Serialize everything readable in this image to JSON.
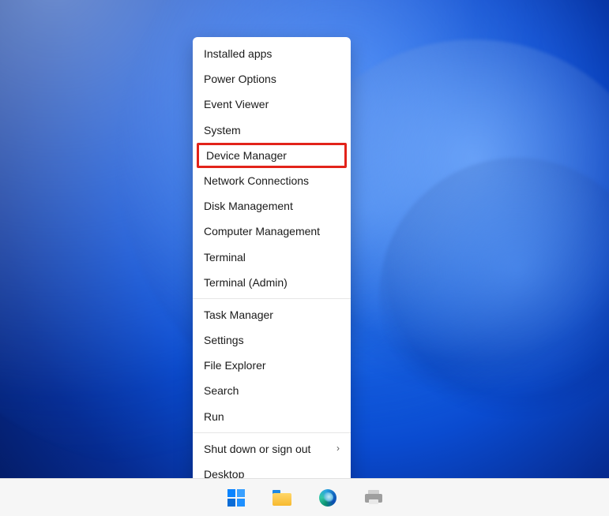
{
  "menu": {
    "groups": [
      [
        {
          "id": "installed-apps",
          "label": "Installed apps"
        },
        {
          "id": "power-options",
          "label": "Power Options"
        },
        {
          "id": "event-viewer",
          "label": "Event Viewer"
        },
        {
          "id": "system",
          "label": "System"
        },
        {
          "id": "device-manager",
          "label": "Device Manager",
          "highlighted": true
        },
        {
          "id": "network-connections",
          "label": "Network Connections"
        },
        {
          "id": "disk-management",
          "label": "Disk Management"
        },
        {
          "id": "computer-management",
          "label": "Computer Management"
        },
        {
          "id": "terminal",
          "label": "Terminal"
        },
        {
          "id": "terminal-admin",
          "label": "Terminal (Admin)"
        }
      ],
      [
        {
          "id": "task-manager",
          "label": "Task Manager"
        },
        {
          "id": "settings",
          "label": "Settings"
        },
        {
          "id": "file-explorer",
          "label": "File Explorer"
        },
        {
          "id": "search",
          "label": "Search"
        },
        {
          "id": "run",
          "label": "Run"
        }
      ],
      [
        {
          "id": "shut-down",
          "label": "Shut down or sign out",
          "submenu": true
        },
        {
          "id": "desktop",
          "label": "Desktop"
        }
      ]
    ]
  },
  "taskbar": {
    "items": [
      {
        "id": "start",
        "name": "Start"
      },
      {
        "id": "file-explorer",
        "name": "File Explorer"
      },
      {
        "id": "edge",
        "name": "Microsoft Edge"
      },
      {
        "id": "device-app",
        "name": "Device App"
      }
    ]
  },
  "colors": {
    "highlight_border": "#e2231a",
    "menu_bg": "#ffffff",
    "taskbar_bg": "#f6f6f6"
  }
}
